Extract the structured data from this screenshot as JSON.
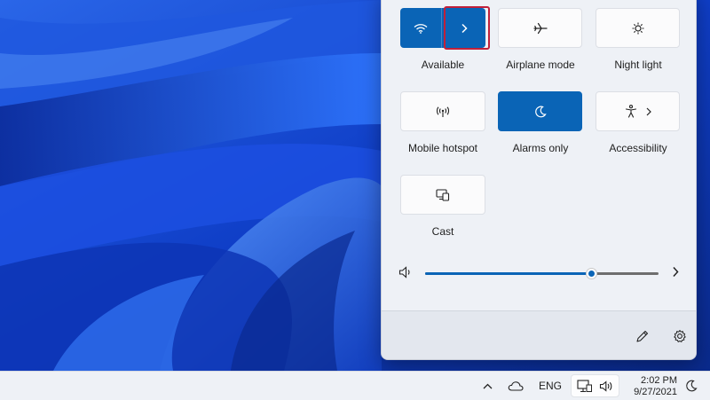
{
  "quick_settings": {
    "wifi": {
      "label": "Available",
      "state": "on"
    },
    "airplane": {
      "label": "Airplane mode",
      "state": "off"
    },
    "night_light": {
      "label": "Night light",
      "state": "off"
    },
    "hotspot": {
      "label": "Mobile hotspot",
      "state": "off"
    },
    "focus": {
      "label": "Alarms only",
      "state": "on"
    },
    "accessibility": {
      "label": "Accessibility",
      "state": "off"
    },
    "cast": {
      "label": "Cast",
      "state": "off"
    },
    "volume": {
      "level": 0.71
    }
  },
  "taskbar": {
    "language": "ENG",
    "time": "2:02 PM",
    "date": "9/27/2021"
  },
  "colors": {
    "accent": "#0a64b6",
    "panel_bg": "#eef1f6",
    "highlight": "#c0203a"
  }
}
